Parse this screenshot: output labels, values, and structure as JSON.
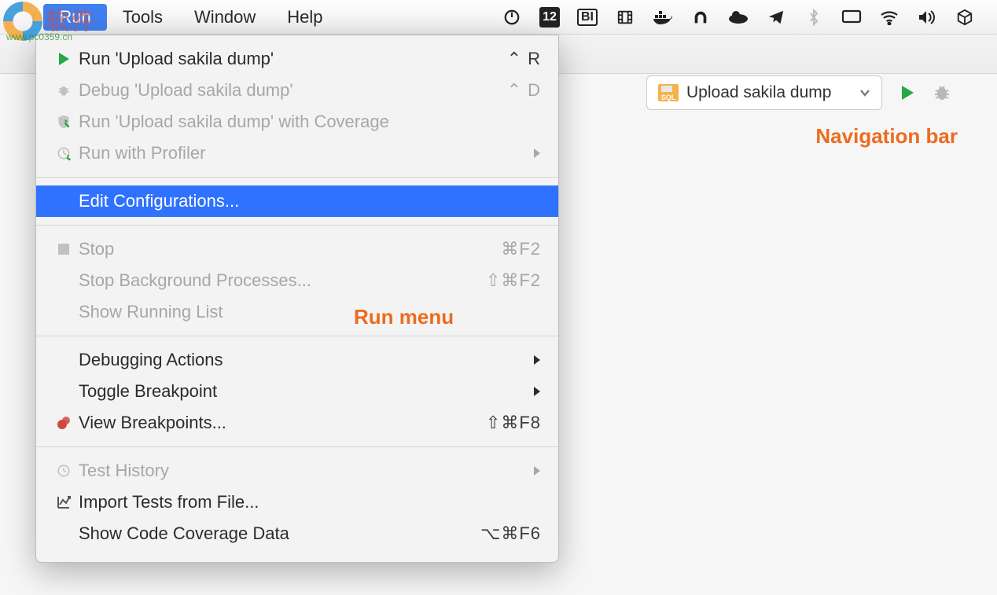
{
  "watermark": {
    "brand": "软件",
    "url": "www.pc0359.cn"
  },
  "menubar": {
    "items": [
      {
        "label": "Run",
        "active": true
      },
      {
        "label": "Tools",
        "active": false
      },
      {
        "label": "Window",
        "active": false
      },
      {
        "label": "Help",
        "active": false
      }
    ],
    "status_day": "12",
    "status_bi": "BI"
  },
  "dropdown": {
    "groups": [
      [
        {
          "icon": "play-icon",
          "iconClass": "play-green",
          "label": "Run 'Upload sakila dump'",
          "shortcut": "⌃ R",
          "disabled": false
        },
        {
          "icon": "bug-icon",
          "iconClass": "bug-gray",
          "label": "Debug 'Upload sakila dump'",
          "shortcut": "⌃ D",
          "disabled": true
        },
        {
          "icon": "coverage-icon",
          "iconClass": "cov-gray",
          "label": "Run 'Upload sakila dump' with Coverage",
          "shortcut": "",
          "disabled": true
        },
        {
          "icon": "profiler-icon",
          "iconClass": "prof-gray",
          "label": "Run with Profiler",
          "shortcut": "",
          "submenu": true,
          "disabled": true
        }
      ],
      [
        {
          "icon": "",
          "iconClass": "",
          "label": "Edit Configurations...",
          "shortcut": "",
          "selected": true
        }
      ],
      [
        {
          "icon": "stop-icon",
          "iconClass": "stop-gray",
          "label": "Stop",
          "shortcut": "⌘F2",
          "disabled": true
        },
        {
          "icon": "",
          "iconClass": "",
          "label": "Stop Background Processes...",
          "shortcut": "⇧⌘F2",
          "disabled": true
        },
        {
          "icon": "",
          "iconClass": "",
          "label": "Show Running List",
          "shortcut": "",
          "disabled": true
        }
      ],
      [
        {
          "icon": "",
          "iconClass": "",
          "label": "Debugging Actions",
          "shortcut": "",
          "submenu": true
        },
        {
          "icon": "",
          "iconClass": "",
          "label": "Toggle Breakpoint",
          "shortcut": "",
          "submenu": true
        },
        {
          "icon": "breakpoint-icon",
          "iconClass": "bp-red",
          "label": "View Breakpoints...",
          "shortcut": "⇧⌘F8"
        }
      ],
      [
        {
          "icon": "clock-icon",
          "iconClass": "clock-gray",
          "label": "Test History",
          "shortcut": "",
          "submenu": true,
          "disabled": true
        },
        {
          "icon": "chart-icon",
          "iconClass": "chart-gray",
          "label": "Import Tests from File...",
          "shortcut": ""
        },
        {
          "icon": "",
          "iconClass": "",
          "label": "Show Code Coverage Data",
          "shortcut": "⌥⌘F6"
        }
      ]
    ]
  },
  "navbar": {
    "config_label": "Upload sakila dump",
    "sql_badge": "SQL"
  },
  "annotations": {
    "run_menu": "Run menu",
    "nav_bar": "Navigation bar"
  }
}
